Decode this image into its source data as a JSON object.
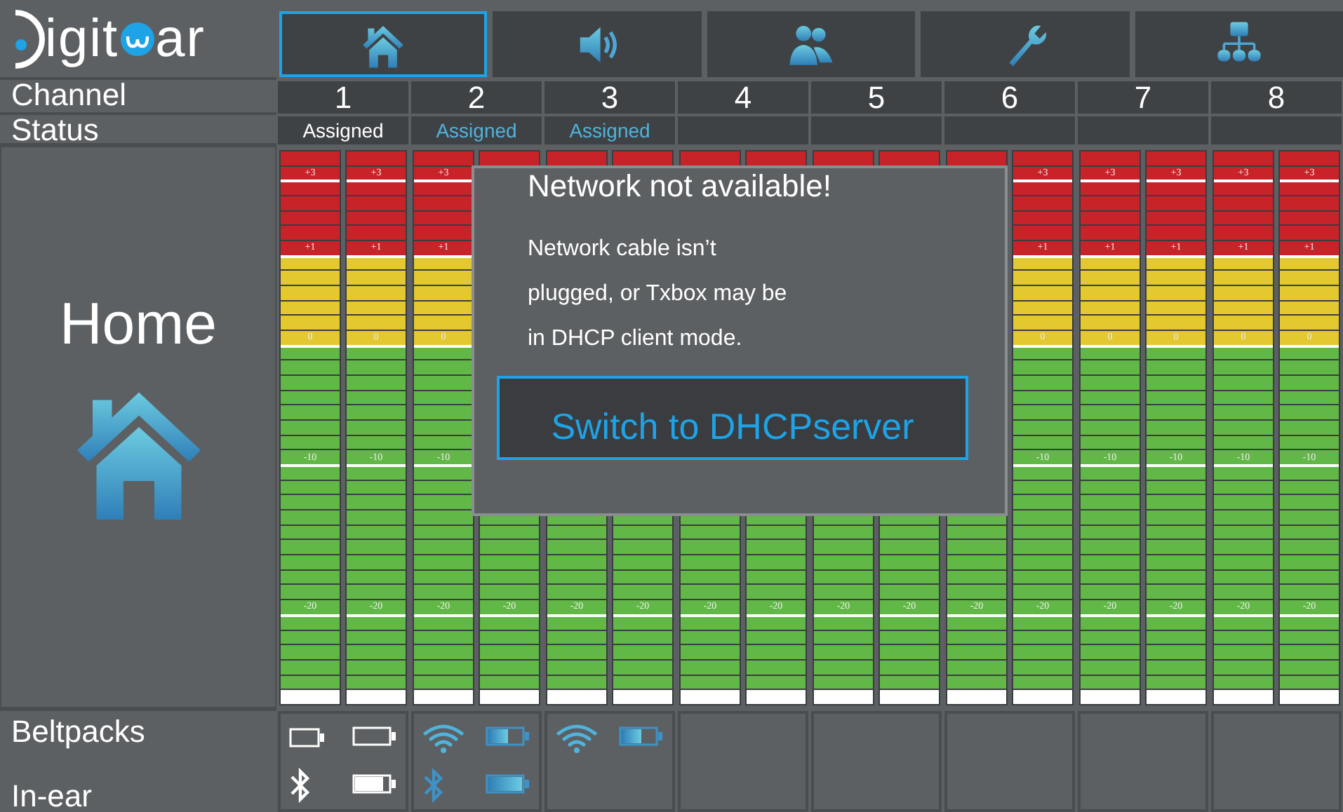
{
  "logo": {
    "parts": [
      "igit",
      "ar"
    ]
  },
  "tabs": [
    {
      "kind": "home",
      "selected": true
    },
    {
      "kind": "speaker",
      "selected": false
    },
    {
      "kind": "people",
      "selected": false
    },
    {
      "kind": "wrench",
      "selected": false
    },
    {
      "kind": "network",
      "selected": false
    }
  ],
  "row_labels": {
    "channel": "Channel",
    "status": "Status",
    "beltpacks": "Beltpacks",
    "in_ear": "In-ear"
  },
  "page": {
    "title": "Home"
  },
  "channels": [
    {
      "number": "1",
      "status": {
        "text": "Assigned",
        "color": "#ffffff"
      },
      "meters": [
        {
          "marks": {
            "m1": "+3",
            "m2": "+1",
            "m3": "0",
            "m4": "-10",
            "m5": "-20"
          }
        },
        {
          "marks": {
            "m1": "+3",
            "m2": "+1",
            "m3": "0",
            "m4": "-10",
            "m5": "-20"
          }
        }
      ],
      "beltpack": {
        "kind": "battery",
        "connected": false
      },
      "in_ear": {
        "connected": false
      }
    },
    {
      "number": "2",
      "status": {
        "text": "Assigned",
        "color": "#4fb3dc"
      },
      "meters": [
        {
          "marks": {
            "m1": "+3",
            "m2": "+1",
            "m3": "0",
            "m4": "-10",
            "m5": "-20"
          }
        },
        {
          "marks": {
            "m5": "-20"
          }
        }
      ],
      "beltpack": {
        "kind": "wifi",
        "connected": true
      },
      "in_ear": {
        "connected": true
      }
    },
    {
      "number": "3",
      "status": {
        "text": "Assigned",
        "color": "#4fb3dc"
      },
      "meters": [
        {
          "marks": {
            "m5": "-20"
          }
        },
        {
          "marks": {
            "m5": "-20"
          }
        }
      ],
      "beltpack": {
        "kind": "wifi",
        "connected": true
      }
    },
    {
      "number": "4",
      "meters": [
        {
          "marks": {
            "m5": "-20"
          }
        },
        {
          "marks": {
            "m5": "-20"
          }
        }
      ]
    },
    {
      "number": "5",
      "meters": [
        {
          "marks": {
            "m5": "-20"
          }
        },
        {
          "marks": {
            "m5": "-20"
          }
        }
      ]
    },
    {
      "number": "6",
      "meters": [
        {
          "marks": {
            "m5": "-20"
          }
        },
        {
          "marks": {
            "m1": "+3",
            "m2": "+1",
            "m3": "0",
            "m4": "-10",
            "m5": "-20"
          }
        }
      ]
    },
    {
      "number": "7",
      "meters": [
        {
          "marks": {
            "m1": "+3",
            "m2": "+1",
            "m3": "0",
            "m4": "-10",
            "m5": "-20"
          }
        },
        {
          "marks": {
            "m1": "+3",
            "m2": "+1",
            "m3": "0",
            "m4": "-10",
            "m5": "-20"
          }
        }
      ]
    },
    {
      "number": "8",
      "meters": [
        {
          "marks": {
            "m1": "+3",
            "m2": "+1",
            "m3": "0",
            "m4": "-10",
            "m5": "-20"
          }
        },
        {
          "marks": {
            "m1": "+3",
            "m2": "+1",
            "m3": "0",
            "m4": "-10",
            "m5": "-20"
          }
        }
      ]
    }
  ],
  "dialog": {
    "title": "Network not available!",
    "message": "Network cable isn’t plugged, or Txbox may be in DHCP client mode.",
    "button": "Switch to DHCPserver"
  }
}
